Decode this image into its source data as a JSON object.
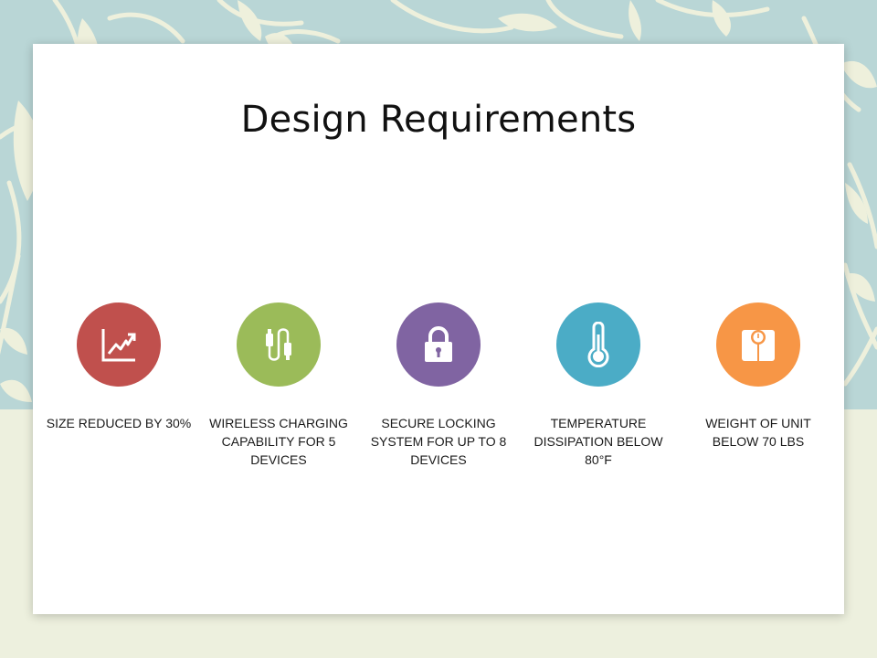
{
  "slide": {
    "title": "Design Requirements"
  },
  "requirements": [
    {
      "label": "SIZE REDUCED BY 30%",
      "icon": "trending-chart-icon",
      "color": "#c0504d"
    },
    {
      "label": "WIRELESS CHARGING CAPABILITY FOR 5 DEVICES",
      "icon": "charging-cable-icon",
      "color": "#9bbb59"
    },
    {
      "label": "SECURE LOCKING SYSTEM FOR UP TO 8 DEVICES",
      "icon": "padlock-icon",
      "color": "#8064a2"
    },
    {
      "label": "TEMPERATURE DISSIPATION BELOW 80°F",
      "icon": "thermometer-icon",
      "color": "#4bacc6"
    },
    {
      "label": "WEIGHT OF UNIT BELOW 70 LBS",
      "icon": "scale-icon",
      "color": "#f79646"
    }
  ],
  "colors": {
    "background_top": "#b9d6d6",
    "background_bottom": "#edf0de",
    "leaf_pattern": "#eef0dc"
  }
}
